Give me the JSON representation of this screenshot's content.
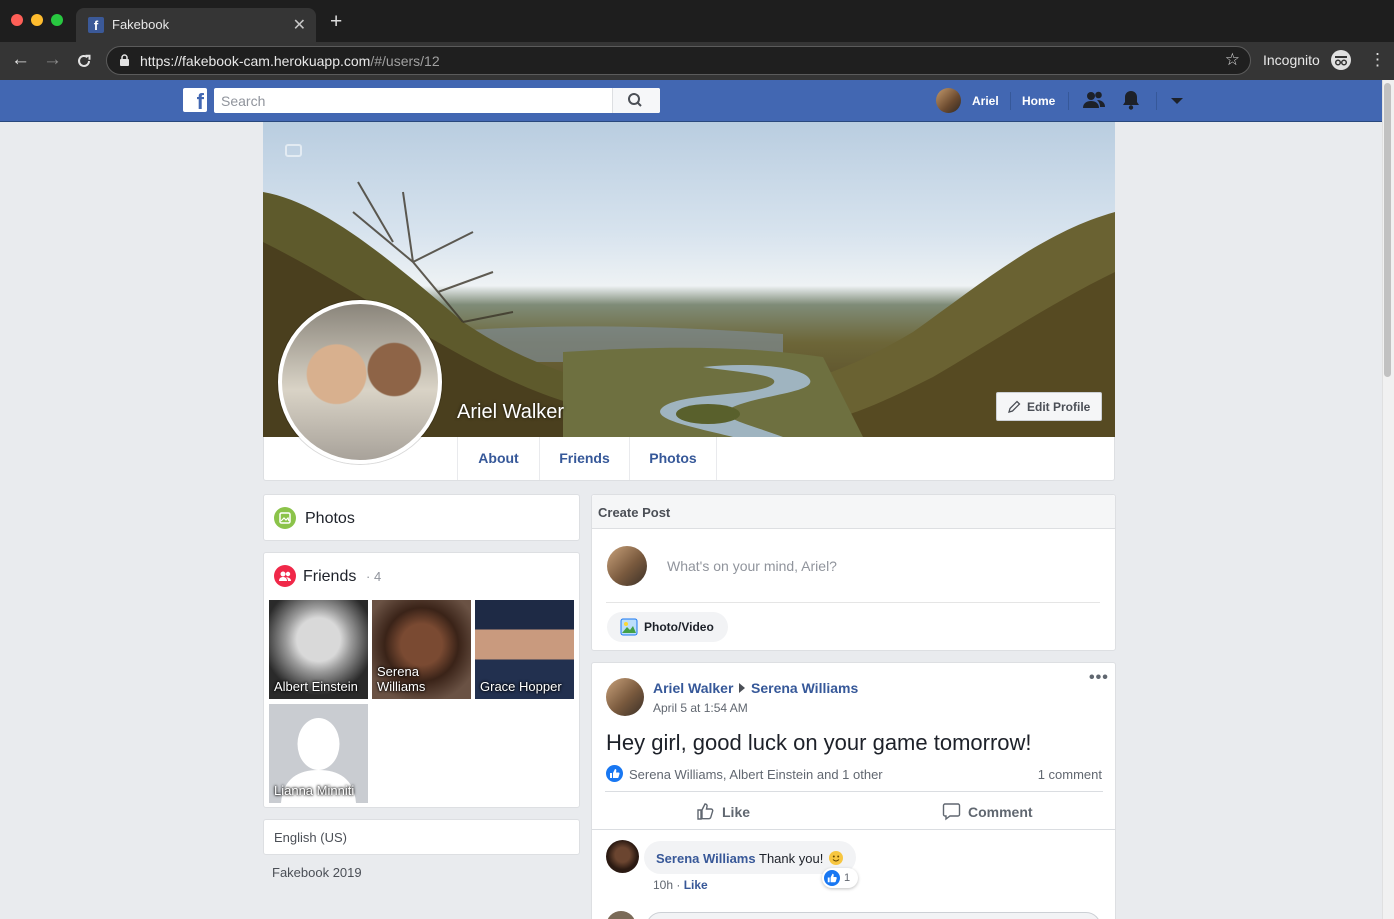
{
  "browser": {
    "tab_title": "Fakebook",
    "tab_favicon": "f",
    "url_host": "https://fakebook-cam.herokuapp.com",
    "url_path": "/#/users/12",
    "mode_label": "Incognito"
  },
  "topnav": {
    "logo": "f",
    "search_placeholder": "Search",
    "user_name": "Ariel",
    "home_label": "Home",
    "icons": [
      "friend-requests-icon",
      "notifications-icon",
      "account-menu-icon"
    ]
  },
  "profile": {
    "name": "Ariel Walker",
    "edit_label": "Edit Profile",
    "tabs": [
      {
        "label": "About"
      },
      {
        "label": "Friends"
      },
      {
        "label": "Photos"
      }
    ]
  },
  "sidebar": {
    "photos_title": "Photos",
    "friends_title": "Friends",
    "friends_count": "· 4",
    "friends": [
      {
        "name": "Albert Einstein"
      },
      {
        "name": "Serena Williams"
      },
      {
        "name": "Grace Hopper"
      },
      {
        "name": "Lianna Minniti"
      }
    ],
    "language": "English (US)",
    "copyright": "Fakebook 2019"
  },
  "create_post": {
    "title": "Create Post",
    "placeholder": "What's on your mind, Ariel?",
    "photo_video_label": "Photo/Video"
  },
  "post": {
    "author": "Ariel Walker",
    "target": "Serena Williams",
    "time": "April 5 at 1:54 AM",
    "more": "•••",
    "text": "Hey girl, good luck on your game tomorrow!",
    "likers": "Serena Williams, Albert Einstein and 1 other",
    "comment_count": "1 comment",
    "like_label": "Like",
    "comment_label": "Comment",
    "comment": {
      "author": "Serena Williams",
      "text": "Thank you!",
      "time": "10h · ",
      "like_label": "Like",
      "reaction_count": "1"
    }
  },
  "colors": {
    "brand": "#4267b2",
    "link": "#365899",
    "background": "#e9ebee"
  }
}
